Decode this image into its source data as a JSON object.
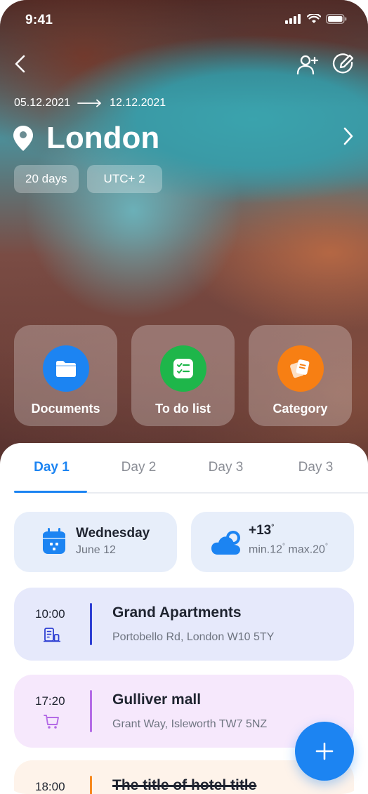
{
  "status": {
    "time": "9:41"
  },
  "trip": {
    "start_date": "05.12.2021",
    "end_date": "12.12.2021",
    "city": "London",
    "duration": "20 days",
    "timezone": "UTC+ 2"
  },
  "quick_actions": [
    {
      "label": "Documents",
      "color": "#1c84f2",
      "icon": "folder-icon"
    },
    {
      "label": "To do list",
      "color": "#1eb64a",
      "icon": "checklist-icon"
    },
    {
      "label": "Category",
      "color": "#f77f13",
      "icon": "category-icon"
    }
  ],
  "tabs": [
    {
      "label": "Day 1",
      "active": true
    },
    {
      "label": "Day 2",
      "active": false
    },
    {
      "label": "Day 3",
      "active": false
    },
    {
      "label": "Day 3",
      "active": false
    }
  ],
  "date_card": {
    "weekday": "Wednesday",
    "date": "June 12"
  },
  "weather_card": {
    "temp": "+13",
    "temp_unit": "°",
    "min_label": "min.12",
    "max_label": "max.20",
    "deg": "°"
  },
  "events": [
    {
      "time": "10:00",
      "title": "Grand Apartments",
      "address": "Portobello Rd, London W10 5TY",
      "accent": "#2e3fd3",
      "bg": "#e6e9fb",
      "icon": "building-icon"
    },
    {
      "time": "17:20",
      "title": "Gulliver mall",
      "address": "Grant Way, Isleworth TW7 5NZ",
      "accent": "#b46be6",
      "bg": "#f6e8fc",
      "icon": "cart-icon"
    },
    {
      "time": "18:00",
      "title": "The title of hotel title",
      "address": "",
      "accent": "#f7891f",
      "bg": "#fef3ea",
      "icon": ""
    }
  ],
  "colors": {
    "primary": "#1c84f2",
    "text": "#1f2430",
    "muted": "#6e7480"
  }
}
